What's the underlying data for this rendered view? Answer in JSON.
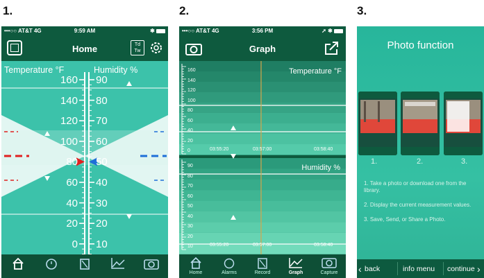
{
  "steps": [
    "1.",
    "2.",
    "3."
  ],
  "status": {
    "carrier": "•••○○ AT&T  4G",
    "time1": "9:59 AM",
    "time2": "3:56 PM"
  },
  "home": {
    "title": "Home",
    "temp_header": "Temperature °F",
    "hum_header": "Humidity %",
    "temp_ticks": [
      "160",
      "140",
      "120",
      "100",
      "80",
      "60",
      "40",
      "20",
      "0"
    ],
    "hum_ticks": [
      "90",
      "80",
      "70",
      "60",
      "50",
      "40",
      "30",
      "20",
      "10"
    ],
    "temp_value_f": 80,
    "hum_value_pct": 50
  },
  "graph": {
    "title": "Graph",
    "temp_header": "Temperature °F",
    "hum_header": "Humidity %",
    "temp_ticks": [
      "160",
      "140",
      "120",
      "100",
      "80",
      "60",
      "40",
      "20",
      "0"
    ],
    "hum_ticks": [
      "90",
      "80",
      "70",
      "60",
      "50",
      "40",
      "30",
      "20",
      "10"
    ],
    "times": [
      "03:55:20",
      "03:57:00",
      "03:58:40"
    ]
  },
  "tabs": [
    {
      "label": "Home",
      "icon": "home-icon"
    },
    {
      "label": "Alarms",
      "icon": "alarm-icon"
    },
    {
      "label": "Record",
      "icon": "record-icon"
    },
    {
      "label": "Graph",
      "icon": "graph-icon"
    },
    {
      "label": "Capture",
      "icon": "camera-icon"
    }
  ],
  "photo": {
    "title": "Photo function",
    "nums": [
      "1.",
      "2.",
      "3."
    ],
    "steps": [
      "1. Take a photo or download one from the library.",
      "2. Display the current measurement values.",
      "3. Save, Send, or Share a Photo."
    ],
    "back": "back",
    "info": "info menu",
    "continue": "continue"
  },
  "colors": {
    "bar_dark": "#0e5a3e",
    "teal": "#3cc2aa",
    "red_marker": "#e02020",
    "blue_marker": "#1e6fd8"
  }
}
